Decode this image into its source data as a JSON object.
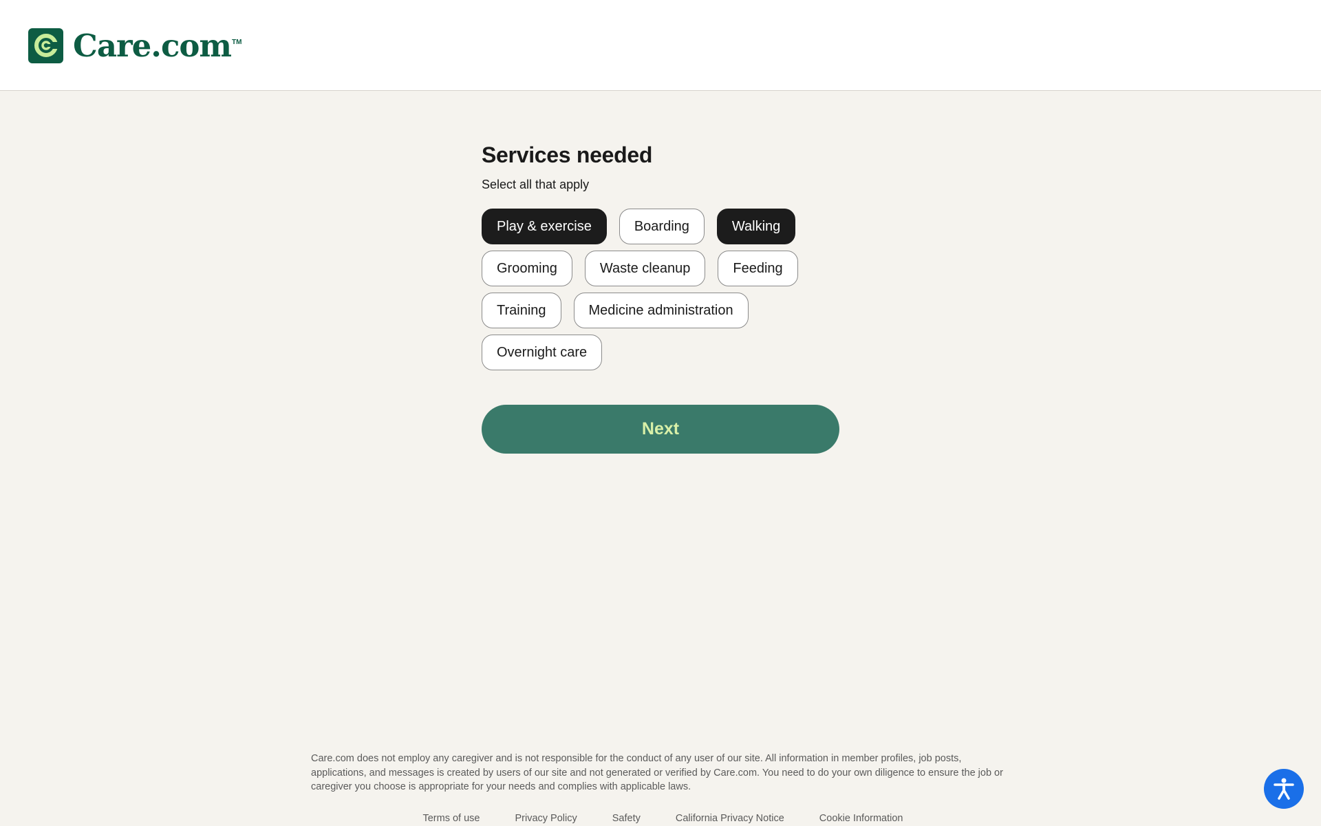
{
  "header": {
    "brand": "Care.com",
    "trademark": "TM"
  },
  "main": {
    "title": "Services needed",
    "subtitle": "Select all that apply",
    "services": [
      {
        "label": "Play & exercise",
        "selected": true
      },
      {
        "label": "Boarding",
        "selected": false
      },
      {
        "label": "Walking",
        "selected": true
      },
      {
        "label": "Grooming",
        "selected": false
      },
      {
        "label": "Waste cleanup",
        "selected": false
      },
      {
        "label": "Feeding",
        "selected": false
      },
      {
        "label": "Training",
        "selected": false
      },
      {
        "label": "Medicine administration",
        "selected": false
      },
      {
        "label": "Overnight care",
        "selected": false
      }
    ],
    "next_label": "Next"
  },
  "footer": {
    "disclaimer": "Care.com does not employ any caregiver and is not responsible for the conduct of any user of our site. All information in member profiles, job posts, applications, and messages is created by users of our site and not generated or verified by Care.com. You need to do your own diligence to ensure the job or caregiver you choose is appropriate for your needs and complies with applicable laws.",
    "links": [
      "Terms of use",
      "Privacy Policy",
      "Safety",
      "California Privacy Notice",
      "Cookie Information"
    ]
  },
  "colors": {
    "brand_green": "#0d5c43",
    "next_button": "#3a7a6a",
    "next_text": "#d9f0a8",
    "chip_selected": "#1c1c1c",
    "page_background": "#f5f3ee",
    "accessibility_blue": "#1a6fe8"
  },
  "icons": {
    "logo": "care-logo-icon",
    "accessibility": "accessibility-icon"
  }
}
